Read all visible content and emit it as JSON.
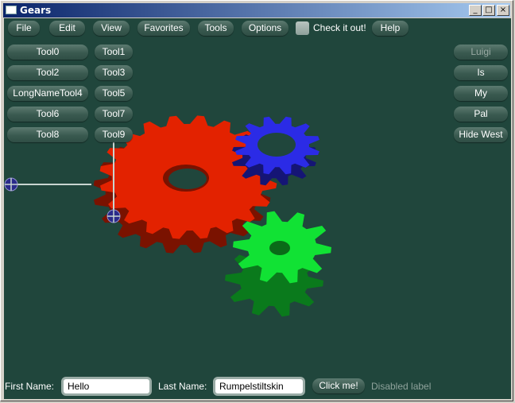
{
  "window": {
    "title": "Gears",
    "min_glyph": "_",
    "max_glyph": "□",
    "close_glyph": "×"
  },
  "menu": {
    "items": [
      "File",
      "Edit",
      "View",
      "Favorites",
      "Tools",
      "Options"
    ],
    "check_label": "Check it out!",
    "help": "Help"
  },
  "west_tools": [
    "Tool0",
    "Tool1",
    "Tool2",
    "Tool3",
    "LongNameTool4",
    "Tool5",
    "Tool6",
    "Tool7",
    "Tool8",
    "Tool9"
  ],
  "east_buttons": [
    "Luigi",
    "Is",
    "My",
    "Pal",
    "Hide West"
  ],
  "footer": {
    "first_label": "First Name:",
    "first_value": "Hello",
    "last_label": "Last Name:",
    "last_value": "Rumpelstiltskin",
    "button": "Click me!",
    "disabled_label": "Disabled label"
  },
  "colors": {
    "background": "#20463c",
    "red_gear": "#e32200",
    "blue_gear": "#2b2be6",
    "green_gear": "#11e234"
  }
}
